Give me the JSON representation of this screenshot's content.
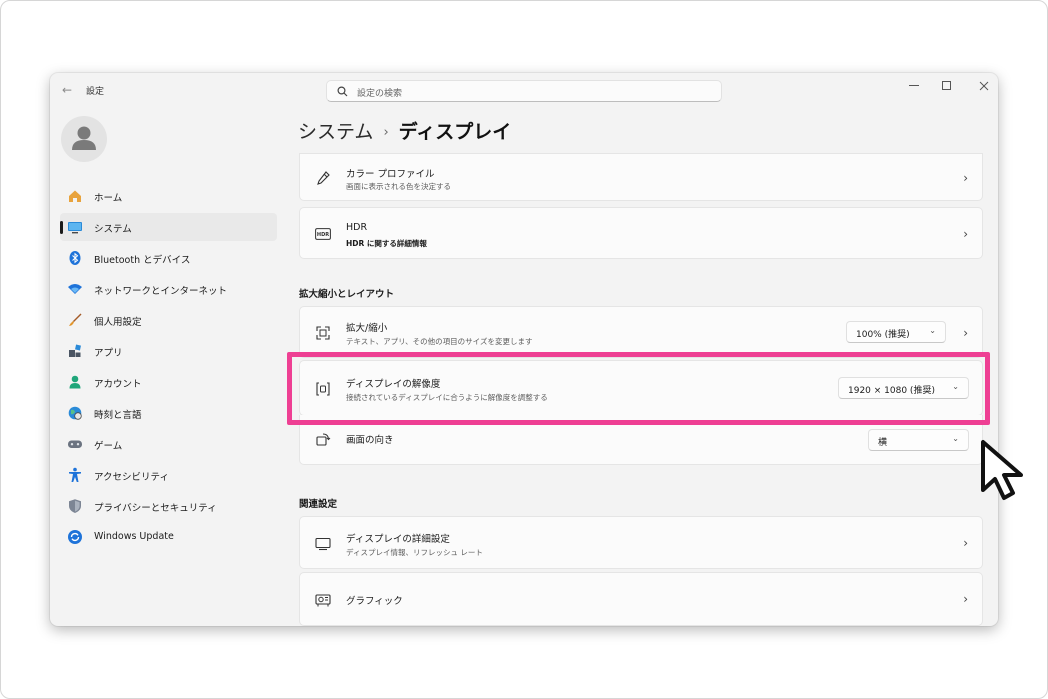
{
  "app": {
    "title": "設定",
    "back_label": "←"
  },
  "search": {
    "placeholder": "設定の検索"
  },
  "sidebar": {
    "items": [
      {
        "label": "ホーム",
        "icon": "home-icon"
      },
      {
        "label": "システム",
        "icon": "system-icon",
        "active": true
      },
      {
        "label": "Bluetooth とデバイス",
        "icon": "bluetooth-icon"
      },
      {
        "label": "ネットワークとインターネット",
        "icon": "wifi-icon"
      },
      {
        "label": "個人用設定",
        "icon": "brush-icon"
      },
      {
        "label": "アプリ",
        "icon": "apps-icon"
      },
      {
        "label": "アカウント",
        "icon": "account-icon"
      },
      {
        "label": "時刻と言語",
        "icon": "globe-icon"
      },
      {
        "label": "ゲーム",
        "icon": "gamepad-icon"
      },
      {
        "label": "アクセシビリティ",
        "icon": "accessibility-icon"
      },
      {
        "label": "プライバシーとセキュリティ",
        "icon": "shield-icon"
      },
      {
        "label": "Windows Update",
        "icon": "update-icon"
      }
    ]
  },
  "breadcrumb": {
    "parent": "システム",
    "separator": "›",
    "current": "ディスプレイ"
  },
  "cards": {
    "color_profile": {
      "title": "カラー プロファイル",
      "subtitle": "画面に表示される色を決定する"
    },
    "hdr": {
      "title": "HDR",
      "subtitle": "HDR に関する詳細情報"
    }
  },
  "sections": {
    "scale_layout": "拡大縮小とレイアウト",
    "related": "関連設定"
  },
  "scale": {
    "title": "拡大/縮小",
    "subtitle": "テキスト、アプリ、その他の項目のサイズを変更します",
    "value": "100% (推奨)"
  },
  "resolution": {
    "title": "ディスプレイの解像度",
    "subtitle": "接続されているディスプレイに合うように解像度を調整する",
    "value": "1920 × 1080 (推奨)"
  },
  "orientation": {
    "title": "画面の向き",
    "value": "横"
  },
  "related": {
    "advanced": {
      "title": "ディスプレイの詳細設定",
      "subtitle": "ディスプレイ情報、リフレッシュ レート"
    },
    "graphics": {
      "title": "グラフィック"
    }
  },
  "colors": {
    "highlight": "#ee3f93",
    "accent": "#0067c0"
  }
}
